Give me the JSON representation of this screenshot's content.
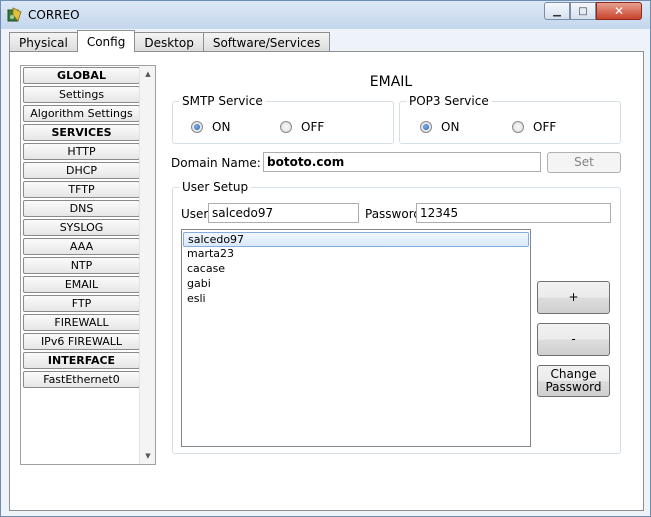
{
  "window": {
    "title": "CORREO",
    "controls": {
      "minimize": "▁",
      "maximize": "□",
      "close": "✕"
    }
  },
  "tabs": [
    {
      "label": "Physical",
      "active": false
    },
    {
      "label": "Config",
      "active": true
    },
    {
      "label": "Desktop",
      "active": false
    },
    {
      "label": "Software/Services",
      "active": false
    }
  ],
  "sidebar": {
    "items": [
      {
        "label": "GLOBAL",
        "header": true
      },
      {
        "label": "Settings",
        "header": false
      },
      {
        "label": "Algorithm Settings",
        "header": false
      },
      {
        "label": "SERVICES",
        "header": true
      },
      {
        "label": "HTTP",
        "header": false
      },
      {
        "label": "DHCP",
        "header": false
      },
      {
        "label": "TFTP",
        "header": false
      },
      {
        "label": "DNS",
        "header": false
      },
      {
        "label": "SYSLOG",
        "header": false
      },
      {
        "label": "AAA",
        "header": false
      },
      {
        "label": "NTP",
        "header": false
      },
      {
        "label": "EMAIL",
        "header": false
      },
      {
        "label": "FTP",
        "header": false
      },
      {
        "label": "FIREWALL",
        "header": false
      },
      {
        "label": "IPv6 FIREWALL",
        "header": false
      },
      {
        "label": "INTERFACE",
        "header": true
      },
      {
        "label": "FastEthernet0",
        "header": false
      }
    ]
  },
  "email": {
    "title": "EMAIL",
    "smtp": {
      "legend": "SMTP Service",
      "on_label": "ON",
      "off_label": "OFF",
      "selected": "ON"
    },
    "pop3": {
      "legend": "POP3 Service",
      "on_label": "ON",
      "off_label": "OFF",
      "selected": "ON"
    },
    "domain": {
      "label": "Domain Name:",
      "value": "bototo.com",
      "set_button": "Set"
    },
    "user_setup": {
      "legend": "User Setup",
      "user_label": "User",
      "user_value": "salcedo97",
      "password_label": "Password",
      "password_value": "12345",
      "users": [
        "salcedo97",
        "marta23",
        "cacase",
        "gabi",
        "esli"
      ],
      "selected_user": "salcedo97",
      "add_button": "+",
      "remove_button": "-",
      "change_password_button": "Change Password"
    }
  },
  "colors": {
    "titlebar": "#c5d7ee",
    "close_button": "#c8432d",
    "selection": "#d9e9fc"
  }
}
